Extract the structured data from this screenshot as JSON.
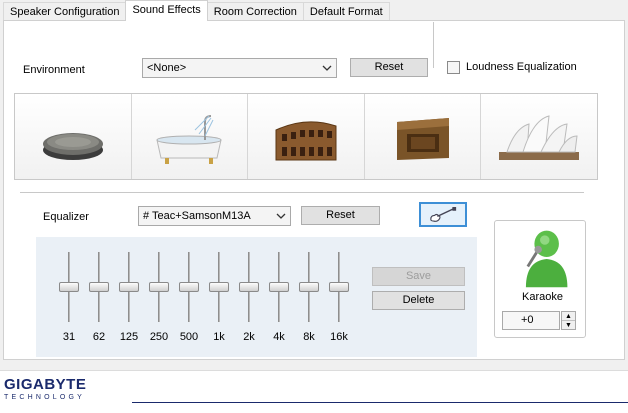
{
  "tabs": [
    {
      "label": "Speaker Configuration",
      "active": false
    },
    {
      "label": "Sound Effects",
      "active": true
    },
    {
      "label": "Room Correction",
      "active": false
    },
    {
      "label": "Default Format",
      "active": false
    }
  ],
  "environment": {
    "label": "Environment",
    "selected": "<None>",
    "reset_label": "Reset",
    "environments": [
      "stone-icon",
      "bathtub-icon",
      "colosseum-icon",
      "box-icon",
      "opera-house-icon"
    ]
  },
  "loudness": {
    "label": "Loudness Equalization",
    "checked": false
  },
  "equalizer": {
    "label": "Equalizer",
    "selected": "# Teac+SamsonM13A",
    "reset_label": "Reset",
    "save_label": "Save",
    "delete_label": "Delete",
    "bands": [
      {
        "freq": "31",
        "level": 0.5
      },
      {
        "freq": "62",
        "level": 0.5
      },
      {
        "freq": "125",
        "level": 0.5
      },
      {
        "freq": "250",
        "level": 0.5
      },
      {
        "freq": "500",
        "level": 0.5
      },
      {
        "freq": "1k",
        "level": 0.5
      },
      {
        "freq": "2k",
        "level": 0.5
      },
      {
        "freq": "4k",
        "level": 0.5
      },
      {
        "freq": "8k",
        "level": 0.5
      },
      {
        "freq": "16k",
        "level": 0.5
      }
    ]
  },
  "karaoke": {
    "label": "Karaoke",
    "value": "+0"
  },
  "footer": {
    "brand": "GIGABYTE",
    "sub": "TECHNOLOGY"
  },
  "colors": {
    "accent": "#3d8fd6",
    "brand": "#1a2a6c",
    "karaoke_green": "#4caf50"
  }
}
